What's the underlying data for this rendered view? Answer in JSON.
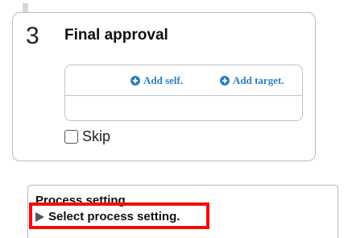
{
  "step": {
    "number": "3",
    "title": "Final approval",
    "add_self_label": "Add self.",
    "add_target_label": "Add target.",
    "skip_label": "Skip",
    "skip_checked": false
  },
  "process": {
    "heading": "Process setting",
    "select_label": "Select process setting."
  },
  "colors": {
    "link": "#2a7fc1",
    "highlight": "#f20c0c",
    "border": "#b9b9b9"
  }
}
